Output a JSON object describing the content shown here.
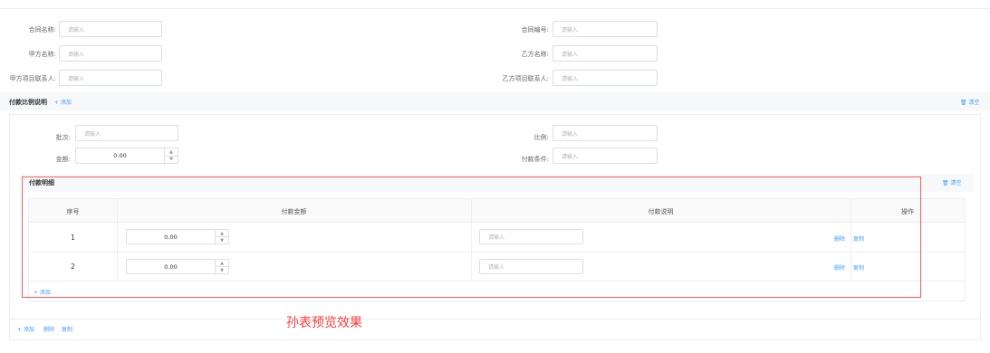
{
  "contract": {
    "name_label": "合同名称:",
    "number_label": "合同编号:",
    "party_a_label": "甲方名称:",
    "party_b_label": "乙方名称:",
    "party_a_contact_label": "甲方项目联系人:",
    "party_b_contact_label": "乙方项目联系人:",
    "placeholder": "请输入"
  },
  "payment_ratio": {
    "title": "付款比例说明",
    "add_label": "+ 添加",
    "clear_label": "清空",
    "batch_label": "批次:",
    "ratio_label": "比例:",
    "amount_label": "金额:",
    "amount_value": "0.00",
    "condition_label": "付款条件:",
    "placeholder": "请输入"
  },
  "payment_detail": {
    "title": "付款明细",
    "clear_label": "清空",
    "columns": [
      "序号",
      "付款金额",
      "付款说明",
      "操作"
    ],
    "rows": [
      {
        "index": "1",
        "amount": "0.00",
        "note_placeholder": "请输入",
        "delete": "删除",
        "copy": "复制"
      },
      {
        "index": "2",
        "amount": "0.00",
        "note_placeholder": "请输入",
        "delete": "删除",
        "copy": "复制"
      }
    ],
    "add_label": "+ 添加"
  },
  "footer": {
    "add_label": "+ 添加",
    "delete_label": "删除",
    "copy_label": "复制"
  },
  "annotation": "孙表预览效果",
  "colors": {
    "link": "#409eff",
    "annotation": "#ff3b3b",
    "border": "#dcdfe6"
  }
}
